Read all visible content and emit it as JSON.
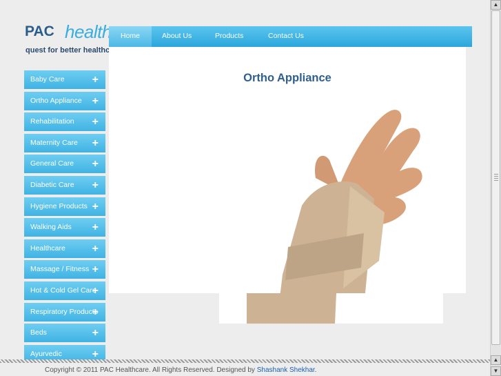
{
  "brand": {
    "pac": "PAC",
    "healthcare": "healthcare",
    "tagline": "quest for better healthcare"
  },
  "nav": {
    "home": "Home",
    "about": "About Us",
    "products": "Products",
    "contact": "Contact Us"
  },
  "content": {
    "title": "Ortho Appliance"
  },
  "sidebar": {
    "items": [
      {
        "label": "Baby Care"
      },
      {
        "label": "Ortho Appliance"
      },
      {
        "label": "Rehabilitation"
      },
      {
        "label": "Maternity Care"
      },
      {
        "label": "General Care"
      },
      {
        "label": "Diabetic Care"
      },
      {
        "label": "Hygiene Products"
      },
      {
        "label": "Walking Aids"
      },
      {
        "label": "Healthcare"
      },
      {
        "label": "Massage / Fitness"
      },
      {
        "label": "Hot & Cold Gel Care"
      },
      {
        "label": "Respiratory Products"
      },
      {
        "label": "Beds"
      },
      {
        "label": "Ayurvedic"
      }
    ],
    "expand_symbol": "+"
  },
  "footer": {
    "text": "Copyright © 2011 PAC Healthcare. All Rights Reserved. Designed by ",
    "designer": "Shashank Shekhar",
    "suffix": "."
  },
  "colors": {
    "accent": "#38aee0",
    "title": "#2e5f8f",
    "brand_dark": "#2b5d8c"
  },
  "icons": {
    "plus": "plus-icon",
    "scroll_up": "arrow-up-icon",
    "scroll_down": "arrow-down-icon"
  }
}
